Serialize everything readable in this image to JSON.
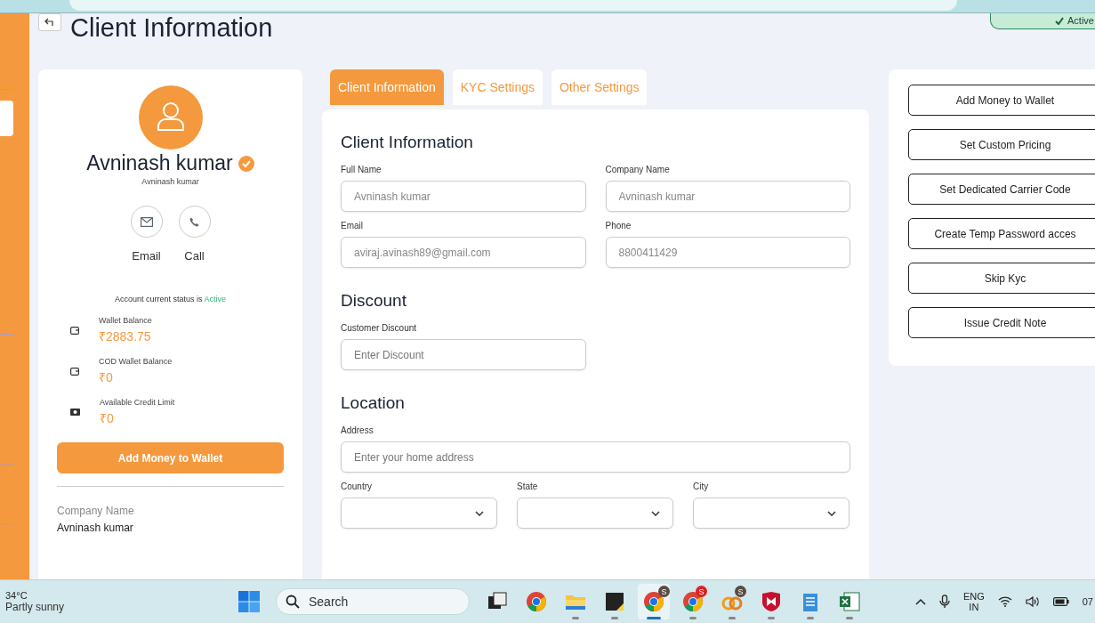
{
  "page": {
    "title": "Client Information",
    "status_badge": "Active"
  },
  "profile": {
    "name": "Avninash kumar",
    "verified": true,
    "subtitle": "Avninash kumar",
    "contacts": [
      {
        "kind": "email",
        "label": "Email"
      },
      {
        "kind": "phone",
        "label": "Call"
      }
    ],
    "status_prefix": "Account current status is",
    "status": "Active",
    "balances": [
      {
        "kind": "wallet",
        "label": "Wallet Balance",
        "value": "₹2883.75"
      },
      {
        "kind": "wallet",
        "label": "COD Wallet Balance",
        "value": "₹0"
      },
      {
        "kind": "cash",
        "label": "Available Credit Limit",
        "value": "₹0"
      }
    ],
    "add_money_button": "Add Money to Wallet",
    "company_label": "Company Name",
    "company_value": "Avninash kumar"
  },
  "tabs": [
    {
      "label": "Client Information",
      "selected": true
    },
    {
      "label": "KYC Settings",
      "selected": false
    },
    {
      "label": "Other Settings",
      "selected": false
    }
  ],
  "form": {
    "sections": [
      {
        "title": "Client Information",
        "rows": [
          [
            {
              "kind": "input",
              "label": "Full Name",
              "value": "Avninash kumar"
            },
            {
              "kind": "input",
              "label": "Company Name",
              "value": "Avninash kumar"
            }
          ],
          [
            {
              "kind": "input",
              "label": "Email",
              "value": "aviraj.avinash89@gmail.com"
            },
            {
              "kind": "input",
              "label": "Phone",
              "value": "8800411429"
            }
          ]
        ]
      },
      {
        "title": "Discount",
        "rows": [
          [
            {
              "kind": "input",
              "label": "Customer Discount",
              "placeholder": "Enter Discount"
            },
            {
              "kind": "empty"
            }
          ]
        ]
      },
      {
        "title": "Location",
        "rows": [
          [
            {
              "kind": "input",
              "label": "Address",
              "placeholder": "Enter your home address"
            }
          ],
          [
            {
              "kind": "select",
              "label": "Country"
            },
            {
              "kind": "select",
              "label": "State"
            },
            {
              "kind": "select",
              "label": "City"
            }
          ]
        ]
      }
    ]
  },
  "actions": [
    "Add Money to Wallet",
    "Set Custom Pricing",
    "Set Dedicated Carrier Code",
    "Create Temp Password acces",
    "Skip Kyc",
    "Issue Credit Note"
  ],
  "taskbar": {
    "temperature": "34°C",
    "weather": "Partly sunny",
    "search_placeholder": "Search",
    "apps": [
      {
        "kind": "taskview",
        "running": false,
        "active": false
      },
      {
        "kind": "chrome",
        "running": false,
        "active": false
      },
      {
        "kind": "folder",
        "running": true,
        "active": false
      },
      {
        "kind": "notes",
        "running": true,
        "active": false
      },
      {
        "kind": "chrome",
        "badge": "S",
        "running": true,
        "active": true
      },
      {
        "kind": "chrome",
        "badge": "S",
        "running": true,
        "active": false
      },
      {
        "kind": "link",
        "badge": "S",
        "running": true,
        "active": false
      },
      {
        "kind": "shield",
        "running": true,
        "active": false
      },
      {
        "kind": "notepad",
        "running": true,
        "active": false
      },
      {
        "kind": "excel",
        "running": true,
        "active": false
      }
    ],
    "language": "ENG",
    "region": "IN",
    "clock": "07"
  }
}
